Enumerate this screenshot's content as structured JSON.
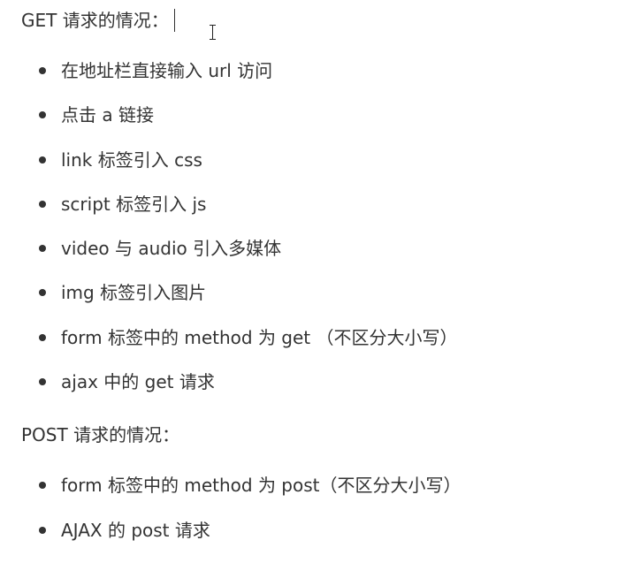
{
  "get_section": {
    "heading": "GET 请求的情况：",
    "items": [
      "在地址栏直接输入 url 访问",
      "点击 a 链接",
      "link 标签引入 css",
      "script 标签引入 js",
      "video 与 audio 引入多媒体",
      "img 标签引入图片",
      "form 标签中的 method 为 get （不区分大小写）",
      "ajax 中的 get 请求"
    ]
  },
  "post_section": {
    "heading": "POST 请求的情况：",
    "items": [
      "form 标签中的 method 为 post（不区分大小写）",
      "AJAX 的 post 请求"
    ]
  },
  "icons": {
    "text_caret": "text-caret-icon",
    "mouse_cursor": "ibeam-cursor-icon",
    "bullet": "bullet-dot-icon"
  },
  "colors": {
    "text": "#333333",
    "background": "#ffffff"
  }
}
